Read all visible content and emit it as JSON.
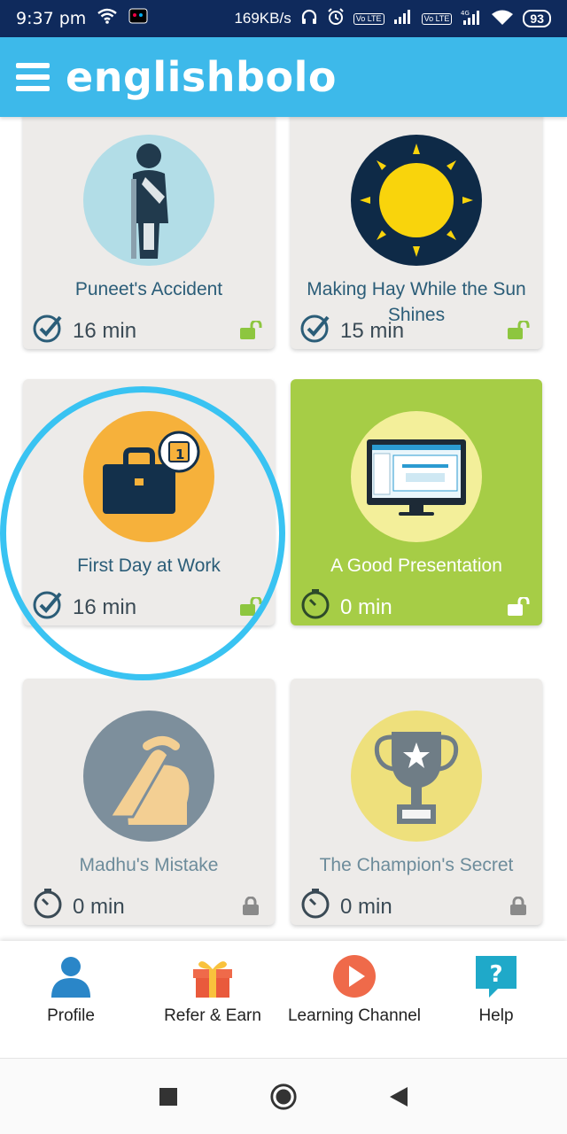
{
  "status_bar": {
    "time": "9:37 pm",
    "network_speed": "169KB/s",
    "volte_label": "Vo LTE",
    "battery": "93",
    "signal_4g": "4G"
  },
  "app_bar": {
    "brand": "englishbolo"
  },
  "cards": [
    {
      "title": "Puneet's Accident",
      "duration": "16 min",
      "status": "completed",
      "lock": "unlocked",
      "icon": "crutch-person-icon",
      "circle_color": "#b2dde7"
    },
    {
      "title": "Making Hay While the Sun Shines",
      "duration": "15 min",
      "status": "completed",
      "lock": "unlocked",
      "icon": "sun-icon",
      "circle_color": "#0e2a47"
    },
    {
      "title": "First Day at Work",
      "duration": "16 min",
      "status": "completed",
      "lock": "unlocked",
      "icon": "briefcase-icon",
      "circle_color": "#f6b13b"
    },
    {
      "title": "A Good Presentation",
      "duration": "0 min",
      "status": "active",
      "lock": "unlocked",
      "icon": "monitor-icon",
      "circle_color": "#f3ef9a"
    },
    {
      "title": "Madhu's Mistake",
      "duration": "0 min",
      "status": "locked",
      "lock": "locked",
      "icon": "facepalm-icon",
      "circle_color": "#7d8f9c"
    },
    {
      "title": "The Champion's Secret",
      "duration": "0 min",
      "status": "locked",
      "lock": "locked",
      "icon": "trophy-icon",
      "circle_color": "#eee07c"
    }
  ],
  "bottom_nav": [
    {
      "label": "Profile",
      "icon": "profile-icon"
    },
    {
      "label": "Refer & Earn",
      "icon": "gift-icon"
    },
    {
      "label": "Learning Channel",
      "icon": "play-icon"
    },
    {
      "label": "Help",
      "icon": "help-icon"
    }
  ],
  "colors": {
    "status_bar": "#0f2a5c",
    "app_bar": "#3db9ea",
    "active_card": "#a6cd46",
    "card": "#edebe9",
    "unlock_icon": "#8dc63f",
    "highlight_ring": "#39c3f2"
  }
}
